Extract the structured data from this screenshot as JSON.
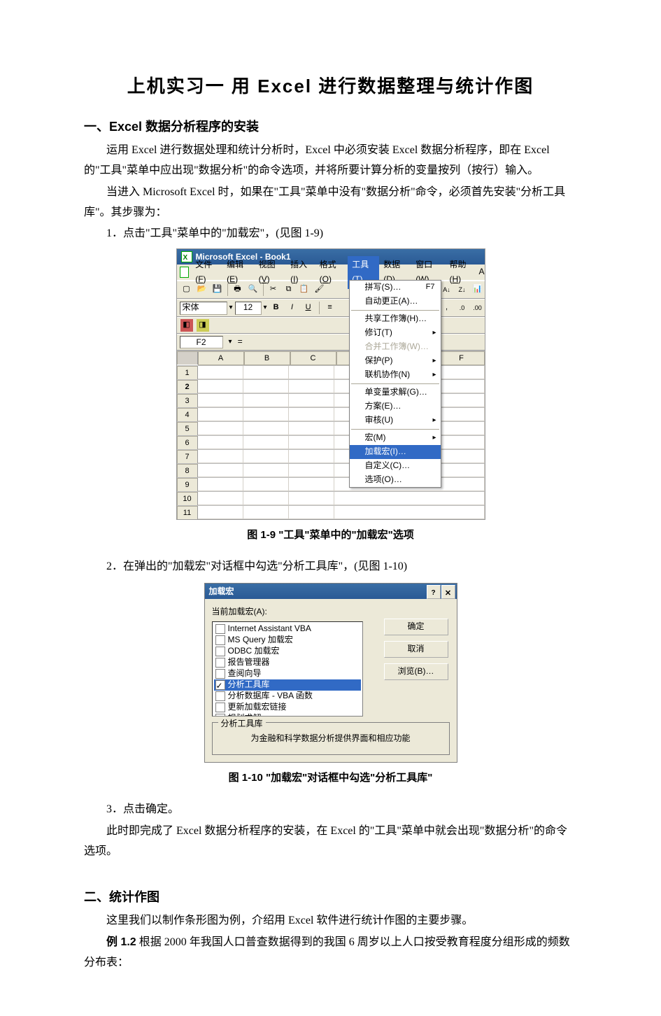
{
  "title": "上机实习一  用 Excel 进行数据整理与统计作图",
  "section1_heading": "一、Excel 数据分析程序的安装",
  "section1_p1": "运用 Excel 进行数据处理和统计分析时，Excel 中必须安装 Excel 数据分析程序，即在 Excel 的\"工具\"菜单中应出现\"数据分析\"的命令选项，并将所要计算分析的变量按列（按行）输入。",
  "section1_p2": "当进入 Microsoft Excel 时，如果在\"工具\"菜单中没有\"数据分析\"命令，必须首先安装\"分析工具库\"。其步骤为：",
  "section1_step1": "1．点击\"工具\"菜单中的\"加载宏\"，(见图 1-9)",
  "fig1": {
    "titlebar": "Microsoft Excel - Book1",
    "menus": {
      "file": {
        "label": "文件",
        "key": "F"
      },
      "edit": {
        "label": "编辑",
        "key": "E"
      },
      "view": {
        "label": "视图",
        "key": "V"
      },
      "insert": {
        "label": "插入",
        "key": "I"
      },
      "format": {
        "label": "格式",
        "key": "O"
      },
      "tools": {
        "label": "工具",
        "key": "T"
      },
      "data": {
        "label": "数据",
        "key": "D"
      },
      "window": {
        "label": "窗口",
        "key": "W"
      },
      "help": {
        "label": "帮助",
        "key": "H"
      }
    },
    "font": "宋体",
    "fontsize": "12",
    "styleB": "B",
    "styleI": "I",
    "styleU": "U",
    "namebox": "F2",
    "formula_eq": "=",
    "columns": [
      "A",
      "B",
      "C",
      "F"
    ],
    "rows": [
      "1",
      "2",
      "3",
      "4",
      "5",
      "6",
      "7",
      "8",
      "9",
      "10",
      "11"
    ],
    "dropdown": {
      "spell": {
        "label": "拼写(S)…",
        "shortcut": "F7"
      },
      "autocorr": "自动更正(A)…",
      "share": "共享工作簿(H)…",
      "track": "修订(T)",
      "merge": "合并工作簿(W)…",
      "protect": "保护(P)",
      "online": "联机协作(N)",
      "goalseek": "单变量求解(G)…",
      "scenario": "方案(E)…",
      "audit": "审核(U)",
      "macro": "宏(M)",
      "addins": "加载宏(I)…",
      "customize": "自定义(C)…",
      "options": "选项(O)…"
    }
  },
  "fig1_caption": "图 1-9  \"工具\"菜单中的\"加载宏\"选项",
  "section1_step2": "2．在弹出的\"加载宏\"对话框中勾选\"分析工具库\"，(见图 1-10)",
  "fig2": {
    "title": "加载宏",
    "label_available": "当前加载宏(A):",
    "items": [
      {
        "label": "Internet Assistant VBA",
        "checked": false
      },
      {
        "label": "MS Query 加载宏",
        "checked": false
      },
      {
        "label": "ODBC 加载宏",
        "checked": false
      },
      {
        "label": "报告管理器",
        "checked": false
      },
      {
        "label": "查阅向导",
        "checked": false
      },
      {
        "label": "分析工具库",
        "checked": true,
        "selected": true
      },
      {
        "label": "分析数据库 - VBA 函数",
        "checked": false
      },
      {
        "label": "更新加载宏链接",
        "checked": false
      },
      {
        "label": "规划求解",
        "checked": false
      }
    ],
    "btn_ok": "确定",
    "btn_cancel": "取消",
    "btn_browse": "浏览(B)…",
    "group_title": "分析工具库",
    "group_desc": "为金融和科学数据分析提供界面和相应功能"
  },
  "fig2_caption": "图 1-10   \"加载宏\"对话框中勾选\"分析工具库\"",
  "section1_step3": "3．点击确定。",
  "section1_p3": "此时即完成了 Excel 数据分析程序的安装，在 Excel 的\"工具\"菜单中就会出现\"数据分析\"的命令选项。",
  "section2_heading": "二、统计作图",
  "section2_p1": "这里我们以制作条形图为例，介绍用 Excel 软件进行统计作图的主要步骤。",
  "section2_ex_label": "例 1.2",
  "section2_ex_text": "  根据 2000 年我国人口普查数据得到的我国 6 周岁以上人口按受教育程度分组形成的频数分布表："
}
